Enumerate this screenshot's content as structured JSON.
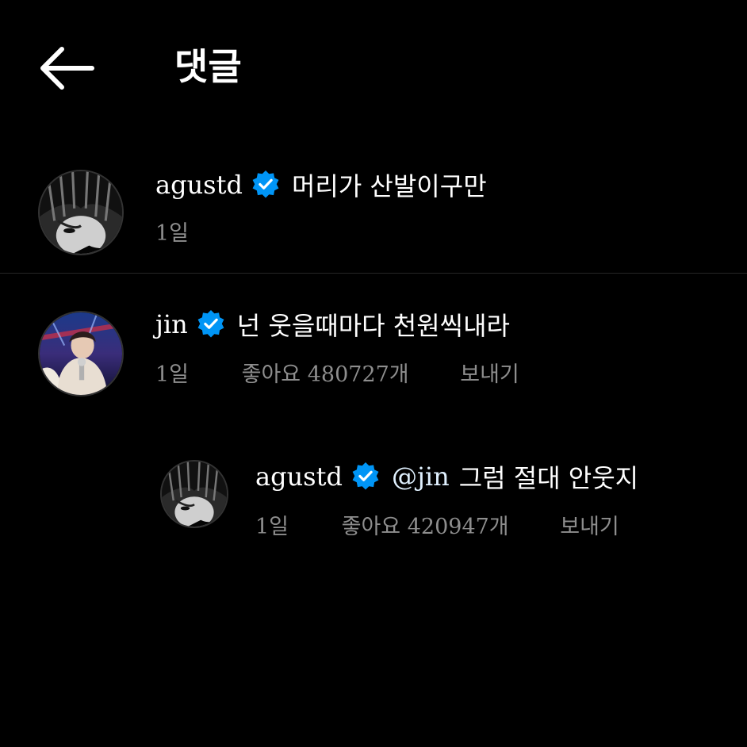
{
  "header": {
    "title": "댓글",
    "back_icon": "arrow-left-icon"
  },
  "colors": {
    "background": "#000000",
    "verified": "#0095f6",
    "meta_text": "#8e8e8e",
    "divider": "#262626"
  },
  "caption": {
    "username": "agustd",
    "text": "머리가 산발이구만",
    "time": "1일"
  },
  "comments": [
    {
      "username": "jin",
      "text": "넌 웃을때마다 천원씩내라",
      "time": "1일",
      "likes": "좋아요 480727개",
      "reply_label": "보내기"
    }
  ],
  "replies": [
    {
      "username": "agustd",
      "mention": "@jin",
      "text": "그럼 절대 안웃지",
      "time": "1일",
      "likes": "좋아요 420947개",
      "reply_label": "보내기"
    }
  ]
}
